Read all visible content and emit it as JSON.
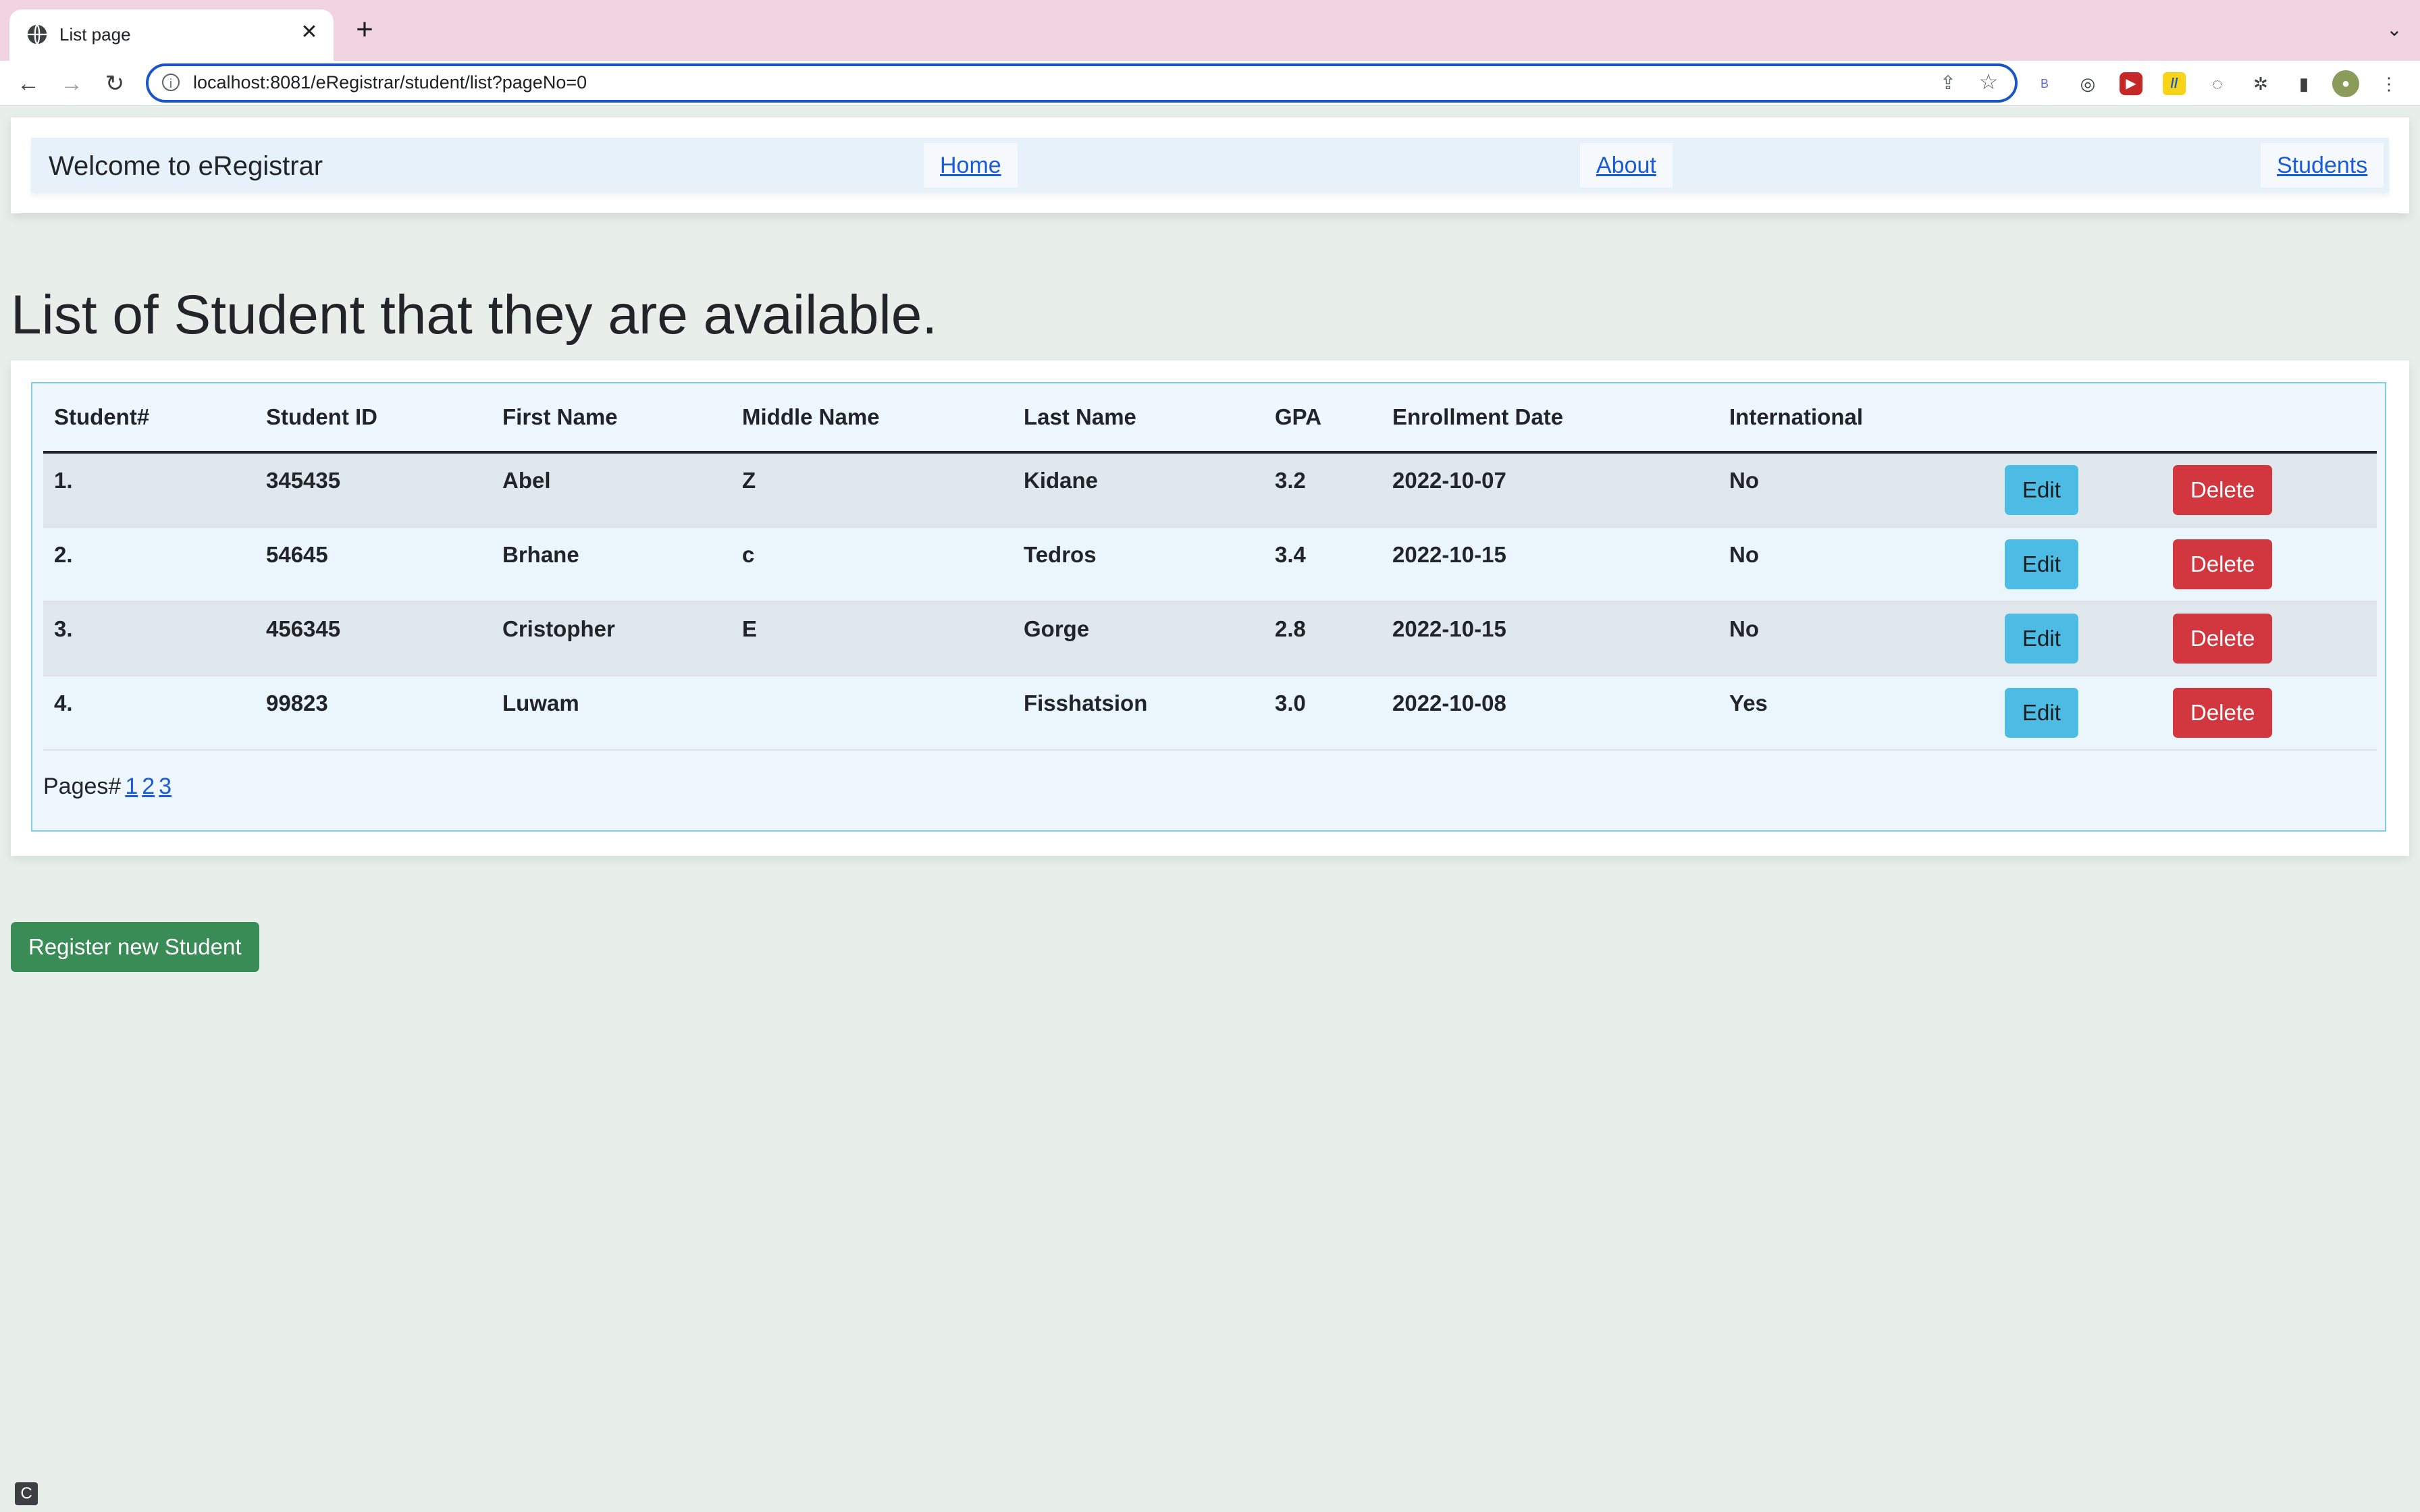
{
  "browser": {
    "tab_title": "List page",
    "new_tab_glyph": "+",
    "close_glyph": "✕",
    "url": "localhost:8081/eRegistrar/student/list?pageNo=0",
    "extensions": [
      "B",
      "◎",
      "▶",
      "//",
      "◌",
      "puzzle-icon",
      "sidebar-icon",
      "profile-avatar"
    ]
  },
  "navbar": {
    "brand": "Welcome to eRegistrar",
    "links": [
      "Home",
      "About",
      "Students"
    ]
  },
  "page": {
    "title": "List of Student that they are available."
  },
  "table": {
    "headers": [
      "Student#",
      "Student ID",
      "First Name",
      "Middle Name",
      "Last Name",
      "GPA",
      "Enrollment Date",
      "International"
    ],
    "rows": [
      {
        "num": "1.",
        "id": "345435",
        "first": "Abel",
        "middle": "Z",
        "last": "Kidane",
        "gpa": "3.2",
        "date": "2022-10-07",
        "intl": "No"
      },
      {
        "num": "2.",
        "id": "54645",
        "first": "Brhane",
        "middle": "c",
        "last": "Tedros",
        "gpa": "3.4",
        "date": "2022-10-15",
        "intl": "No"
      },
      {
        "num": "3.",
        "id": "456345",
        "first": "Cristopher",
        "middle": "E",
        "last": "Gorge",
        "gpa": "2.8",
        "date": "2022-10-15",
        "intl": "No"
      },
      {
        "num": "4.",
        "id": "99823",
        "first": "Luwam",
        "middle": "",
        "last": "Fisshatsion",
        "gpa": "3.0",
        "date": "2022-10-08",
        "intl": "Yes"
      }
    ],
    "edit_label": "Edit",
    "delete_label": "Delete"
  },
  "pager": {
    "label": "Pages#",
    "pages": [
      "1",
      "2",
      "3"
    ]
  },
  "register_label": "Register new Student",
  "colors": {
    "edit": "#4cbce4",
    "delete": "#d2363f",
    "register": "#3a8c57",
    "link": "#1a5bd6"
  }
}
